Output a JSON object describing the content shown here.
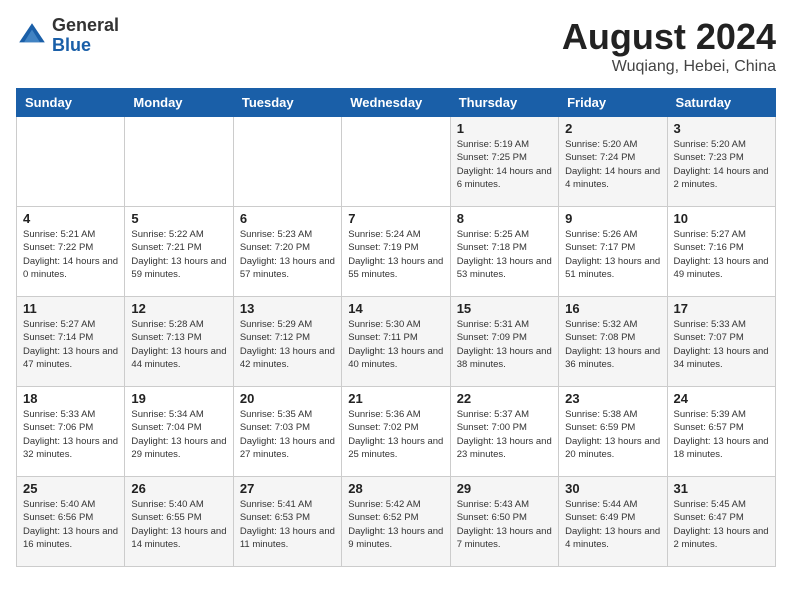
{
  "logo": {
    "general": "General",
    "blue": "Blue"
  },
  "title": {
    "month_year": "August 2024",
    "location": "Wuqiang, Hebei, China"
  },
  "days_of_week": [
    "Sunday",
    "Monday",
    "Tuesday",
    "Wednesday",
    "Thursday",
    "Friday",
    "Saturday"
  ],
  "weeks": [
    [
      {
        "day": "",
        "info": ""
      },
      {
        "day": "",
        "info": ""
      },
      {
        "day": "",
        "info": ""
      },
      {
        "day": "",
        "info": ""
      },
      {
        "day": "1",
        "info": "Sunrise: 5:19 AM\nSunset: 7:25 PM\nDaylight: 14 hours\nand 6 minutes."
      },
      {
        "day": "2",
        "info": "Sunrise: 5:20 AM\nSunset: 7:24 PM\nDaylight: 14 hours\nand 4 minutes."
      },
      {
        "day": "3",
        "info": "Sunrise: 5:20 AM\nSunset: 7:23 PM\nDaylight: 14 hours\nand 2 minutes."
      }
    ],
    [
      {
        "day": "4",
        "info": "Sunrise: 5:21 AM\nSunset: 7:22 PM\nDaylight: 14 hours\nand 0 minutes."
      },
      {
        "day": "5",
        "info": "Sunrise: 5:22 AM\nSunset: 7:21 PM\nDaylight: 13 hours\nand 59 minutes."
      },
      {
        "day": "6",
        "info": "Sunrise: 5:23 AM\nSunset: 7:20 PM\nDaylight: 13 hours\nand 57 minutes."
      },
      {
        "day": "7",
        "info": "Sunrise: 5:24 AM\nSunset: 7:19 PM\nDaylight: 13 hours\nand 55 minutes."
      },
      {
        "day": "8",
        "info": "Sunrise: 5:25 AM\nSunset: 7:18 PM\nDaylight: 13 hours\nand 53 minutes."
      },
      {
        "day": "9",
        "info": "Sunrise: 5:26 AM\nSunset: 7:17 PM\nDaylight: 13 hours\nand 51 minutes."
      },
      {
        "day": "10",
        "info": "Sunrise: 5:27 AM\nSunset: 7:16 PM\nDaylight: 13 hours\nand 49 minutes."
      }
    ],
    [
      {
        "day": "11",
        "info": "Sunrise: 5:27 AM\nSunset: 7:14 PM\nDaylight: 13 hours\nand 47 minutes."
      },
      {
        "day": "12",
        "info": "Sunrise: 5:28 AM\nSunset: 7:13 PM\nDaylight: 13 hours\nand 44 minutes."
      },
      {
        "day": "13",
        "info": "Sunrise: 5:29 AM\nSunset: 7:12 PM\nDaylight: 13 hours\nand 42 minutes."
      },
      {
        "day": "14",
        "info": "Sunrise: 5:30 AM\nSunset: 7:11 PM\nDaylight: 13 hours\nand 40 minutes."
      },
      {
        "day": "15",
        "info": "Sunrise: 5:31 AM\nSunset: 7:09 PM\nDaylight: 13 hours\nand 38 minutes."
      },
      {
        "day": "16",
        "info": "Sunrise: 5:32 AM\nSunset: 7:08 PM\nDaylight: 13 hours\nand 36 minutes."
      },
      {
        "day": "17",
        "info": "Sunrise: 5:33 AM\nSunset: 7:07 PM\nDaylight: 13 hours\nand 34 minutes."
      }
    ],
    [
      {
        "day": "18",
        "info": "Sunrise: 5:33 AM\nSunset: 7:06 PM\nDaylight: 13 hours\nand 32 minutes."
      },
      {
        "day": "19",
        "info": "Sunrise: 5:34 AM\nSunset: 7:04 PM\nDaylight: 13 hours\nand 29 minutes."
      },
      {
        "day": "20",
        "info": "Sunrise: 5:35 AM\nSunset: 7:03 PM\nDaylight: 13 hours\nand 27 minutes."
      },
      {
        "day": "21",
        "info": "Sunrise: 5:36 AM\nSunset: 7:02 PM\nDaylight: 13 hours\nand 25 minutes."
      },
      {
        "day": "22",
        "info": "Sunrise: 5:37 AM\nSunset: 7:00 PM\nDaylight: 13 hours\nand 23 minutes."
      },
      {
        "day": "23",
        "info": "Sunrise: 5:38 AM\nSunset: 6:59 PM\nDaylight: 13 hours\nand 20 minutes."
      },
      {
        "day": "24",
        "info": "Sunrise: 5:39 AM\nSunset: 6:57 PM\nDaylight: 13 hours\nand 18 minutes."
      }
    ],
    [
      {
        "day": "25",
        "info": "Sunrise: 5:40 AM\nSunset: 6:56 PM\nDaylight: 13 hours\nand 16 minutes."
      },
      {
        "day": "26",
        "info": "Sunrise: 5:40 AM\nSunset: 6:55 PM\nDaylight: 13 hours\nand 14 minutes."
      },
      {
        "day": "27",
        "info": "Sunrise: 5:41 AM\nSunset: 6:53 PM\nDaylight: 13 hours\nand 11 minutes."
      },
      {
        "day": "28",
        "info": "Sunrise: 5:42 AM\nSunset: 6:52 PM\nDaylight: 13 hours\nand 9 minutes."
      },
      {
        "day": "29",
        "info": "Sunrise: 5:43 AM\nSunset: 6:50 PM\nDaylight: 13 hours\nand 7 minutes."
      },
      {
        "day": "30",
        "info": "Sunrise: 5:44 AM\nSunset: 6:49 PM\nDaylight: 13 hours\nand 4 minutes."
      },
      {
        "day": "31",
        "info": "Sunrise: 5:45 AM\nSunset: 6:47 PM\nDaylight: 13 hours\nand 2 minutes."
      }
    ]
  ]
}
